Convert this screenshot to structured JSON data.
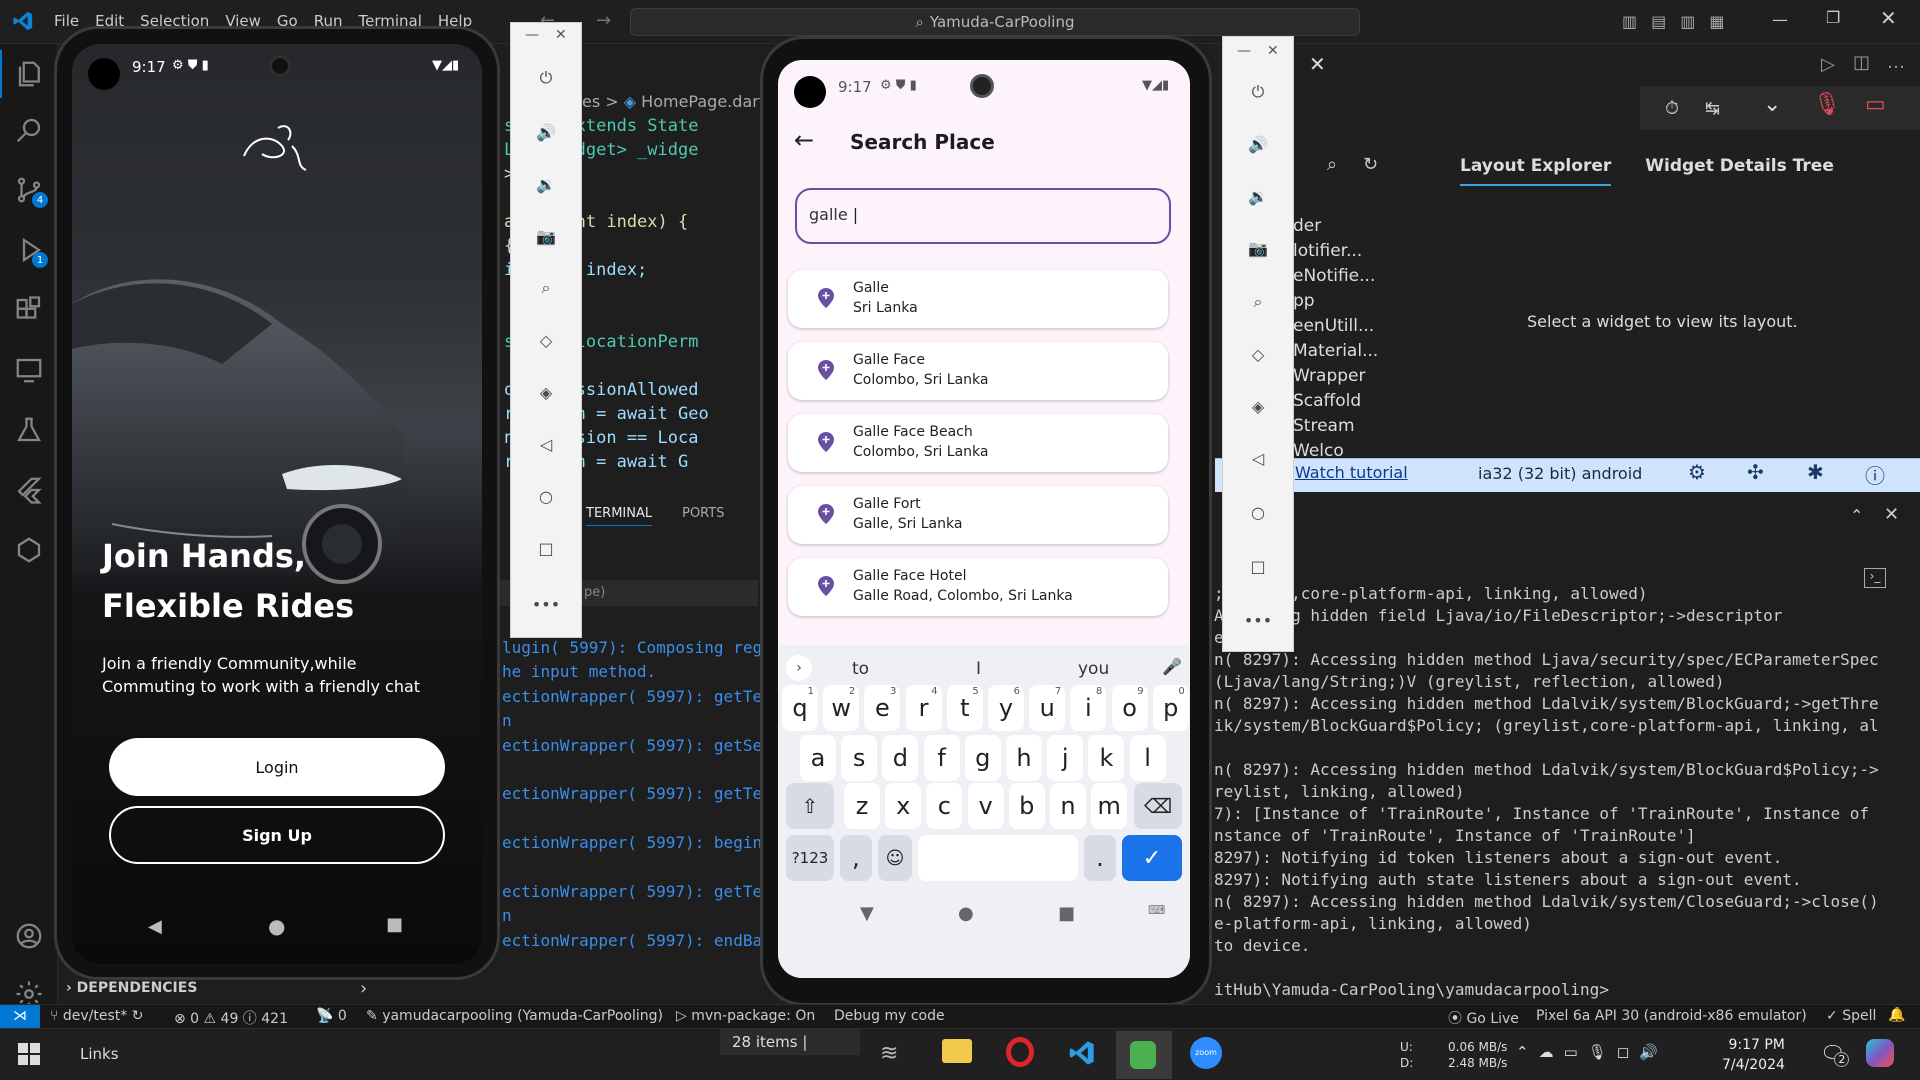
{
  "window": {
    "menus": [
      "File",
      "Edit",
      "Selection",
      "View",
      "Go",
      "Run",
      "Terminal",
      "Help"
    ],
    "search": "Yamuda-CarPooling"
  },
  "activity": {
    "scm_badge": "4",
    "debug_badge": "1"
  },
  "editor": {
    "breadcrumb_tail": "es >",
    "breadcrumb_file": "HomePage.dart",
    "lines": [
      "state extends State",
      "List<Widget> _widge",
      "> []",
      "",
      "apped(int index) {",
      "{",
      "index = index;",
      "",
      "",
      "ssion? locationPerm",
      "",
      "onPermissionAllowed",
      "rmission = await Geo",
      "nPermission == Loca",
      "rmission = await G"
    ]
  },
  "panel_tabs": {
    "terminal": "TERMINAL",
    "ports": "PORTS",
    "filter": "pe)"
  },
  "terminal_left": [
    "lugin( 5997): Composing reg",
    "he input method.",
    "ectionWrapper( 5997): getTe",
    "n",
    "ectionWrapper( 5997): getSe",
    "",
    "ectionWrapper( 5997): getTe",
    "",
    "ectionWrapper( 5997): begin",
    "",
    "ectionWrapper( 5997): getTe",
    "n",
    "ectionWrapper( 5997): endBa"
  ],
  "terminal_right": [
    ";   eylist,core-platform-api, linking, allowed)",
    "    Accessing hidden field Ljava/io/FileDescriptor;->descriptor",
    "    ed)",
    "n( 8297): Accessing hidden method Ljava/security/spec/ECParameterSpec",
    "(Ljava/lang/String;)V (greylist, reflection, allowed)",
    "n( 8297): Accessing hidden method Ldalvik/system/BlockGuard;->getThre",
    "ik/system/BlockGuard$Policy; (greylist,core-platform-api, linking, al",
    "",
    "n( 8297): Accessing hidden method Ldalvik/system/BlockGuard$Policy;->",
    "reylist, linking, allowed)",
    "7): [Instance of 'TrainRoute', Instance of 'TrainRoute', Instance of",
    "nstance of 'TrainRoute', Instance of 'TrainRoute']",
    " 8297): Notifying id token listeners about a sign-out event.",
    " 8297): Notifying auth state listeners about a sign-out event.",
    "n( 8297): Accessing hidden method Ldalvik/system/CloseGuard;->close()",
    "e-platform-api, linking, allowed)",
    " to device.",
    "",
    "itHub\\Yamuda-CarPooling\\yamudacarpooling>"
  ],
  "devtools": {
    "tree_items": [
      "der",
      "lotifier...",
      "eNotifie...",
      "pp",
      "eenUtill...",
      "Material...",
      "Wrapper",
      "Scaffold",
      "Stream",
      "Welco"
    ],
    "tabs": [
      "Layout Explorer",
      "Widget Details Tree"
    ],
    "empty_msg": "Select a widget to view its layout.",
    "watch": "Watch tutorial",
    "target": "ia32 (32 bit) android"
  },
  "phone1": {
    "time": "9:17",
    "headline1": "Join Hands,",
    "headline2": "Flexible Rides",
    "sub1": "Join a friendly Community,while",
    "sub2": "Commuting to work with a friendly chat",
    "login": "Login",
    "signup": "Sign Up"
  },
  "phone2": {
    "time": "9:17",
    "title": "Search Place",
    "query": "galle",
    "results": [
      {
        "name": "Galle",
        "place": "Sri Lanka"
      },
      {
        "name": "Galle Face",
        "place": "Colombo, Sri Lanka"
      },
      {
        "name": "Galle Face Beach",
        "place": "Colombo, Sri Lanka"
      },
      {
        "name": "Galle Fort",
        "place": "Galle, Sri Lanka"
      },
      {
        "name": "Galle Face Hotel",
        "place": "Galle Road, Colombo, Sri Lanka"
      }
    ],
    "suggestions": [
      "to",
      "I",
      "you"
    ],
    "row1": [
      [
        "q",
        "1"
      ],
      [
        "w",
        "2"
      ],
      [
        "e",
        "3"
      ],
      [
        "r",
        "4"
      ],
      [
        "t",
        "5"
      ],
      [
        "y",
        "6"
      ],
      [
        "u",
        "7"
      ],
      [
        "i",
        "8"
      ],
      [
        "o",
        "9"
      ],
      [
        "p",
        "0"
      ]
    ],
    "row2": [
      "a",
      "s",
      "d",
      "f",
      "g",
      "h",
      "j",
      "k",
      "l"
    ],
    "row3": [
      "z",
      "x",
      "c",
      "v",
      "b",
      "n",
      "m"
    ],
    "sym": "?123",
    "comma": ",",
    "period": "."
  },
  "statusbar": {
    "branch": "dev/test*",
    "problems": "⊗ 0 ⚠ 49 ⓘ 421",
    "ports": "0",
    "project": "yamudacarpooling (Yamuda-CarPooling)",
    "mvn": "mvn-package: On",
    "debug": "Debug my code",
    "golive": "Go Live",
    "device": "Pixel 6a API 30 (android-x86 emulator)",
    "spell": "Spell",
    "dependencies": "DEPENDENCIES"
  },
  "taskbar": {
    "links": "Links",
    "items": "28 items",
    "net_u": "U:",
    "net_d": "D:",
    "up": "0.06 MB/s",
    "down": "2.48 MB/s",
    "time": "9:17 PM",
    "date": "7/4/2024",
    "notif": "2"
  }
}
